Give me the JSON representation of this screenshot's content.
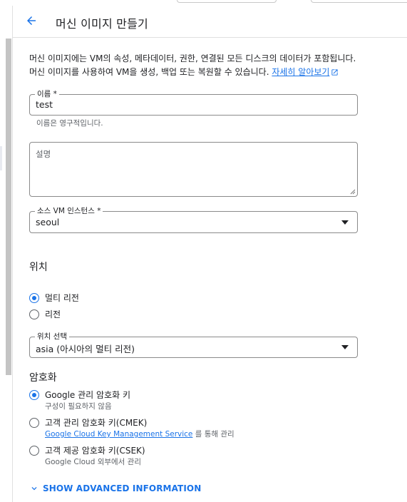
{
  "header": {
    "title": "머신 이미지 만들기",
    "back_icon": "arrow-back-icon"
  },
  "description": {
    "text": "머신 이미지에는 VM의 속성, 메타데이터, 권한, 연결된 모든 디스크의 데이터가 포함됩니다. 머신 이미지를 사용하여 VM을 생성, 백업 또는 복원할 수 있습니다. ",
    "link": "자세히 알아보기",
    "link_icon": "open-in-new-icon"
  },
  "name_field": {
    "label": "이름 *",
    "value": "test",
    "hint": "이름은 영구적입니다."
  },
  "description_field": {
    "placeholder": "설명",
    "value": ""
  },
  "source_vm": {
    "label": "소스 VM 인스턴스 *",
    "value": "seoul"
  },
  "location": {
    "title": "위치",
    "options": [
      {
        "label": "멀티 리전",
        "selected": true
      },
      {
        "label": "리전",
        "selected": false
      }
    ],
    "select_label": "위치 선택",
    "select_value": "asia (아시아의 멀티 리전)"
  },
  "encryption": {
    "title": "암호화",
    "options": [
      {
        "label": "Google 관리 암호화 키",
        "sub": "구성이 필요하지 않음",
        "selected": true
      },
      {
        "label": "고객 관리 암호화 키(CMEK)",
        "sub_link": "Google Cloud Key Management Service",
        "sub_suffix": " 를 통해 관리",
        "selected": false
      },
      {
        "label": "고객 제공 암호화 키(CSEK)",
        "sub": "Google Cloud 외부에서 관리",
        "selected": false
      }
    ]
  },
  "advanced": {
    "label": "SHOW ADVANCED INFORMATION",
    "icon": "chevron-down-icon"
  },
  "colors": {
    "accent": "#1a73e8",
    "text": "#202124",
    "muted": "#5f6368",
    "border": "#8a8a8a"
  }
}
